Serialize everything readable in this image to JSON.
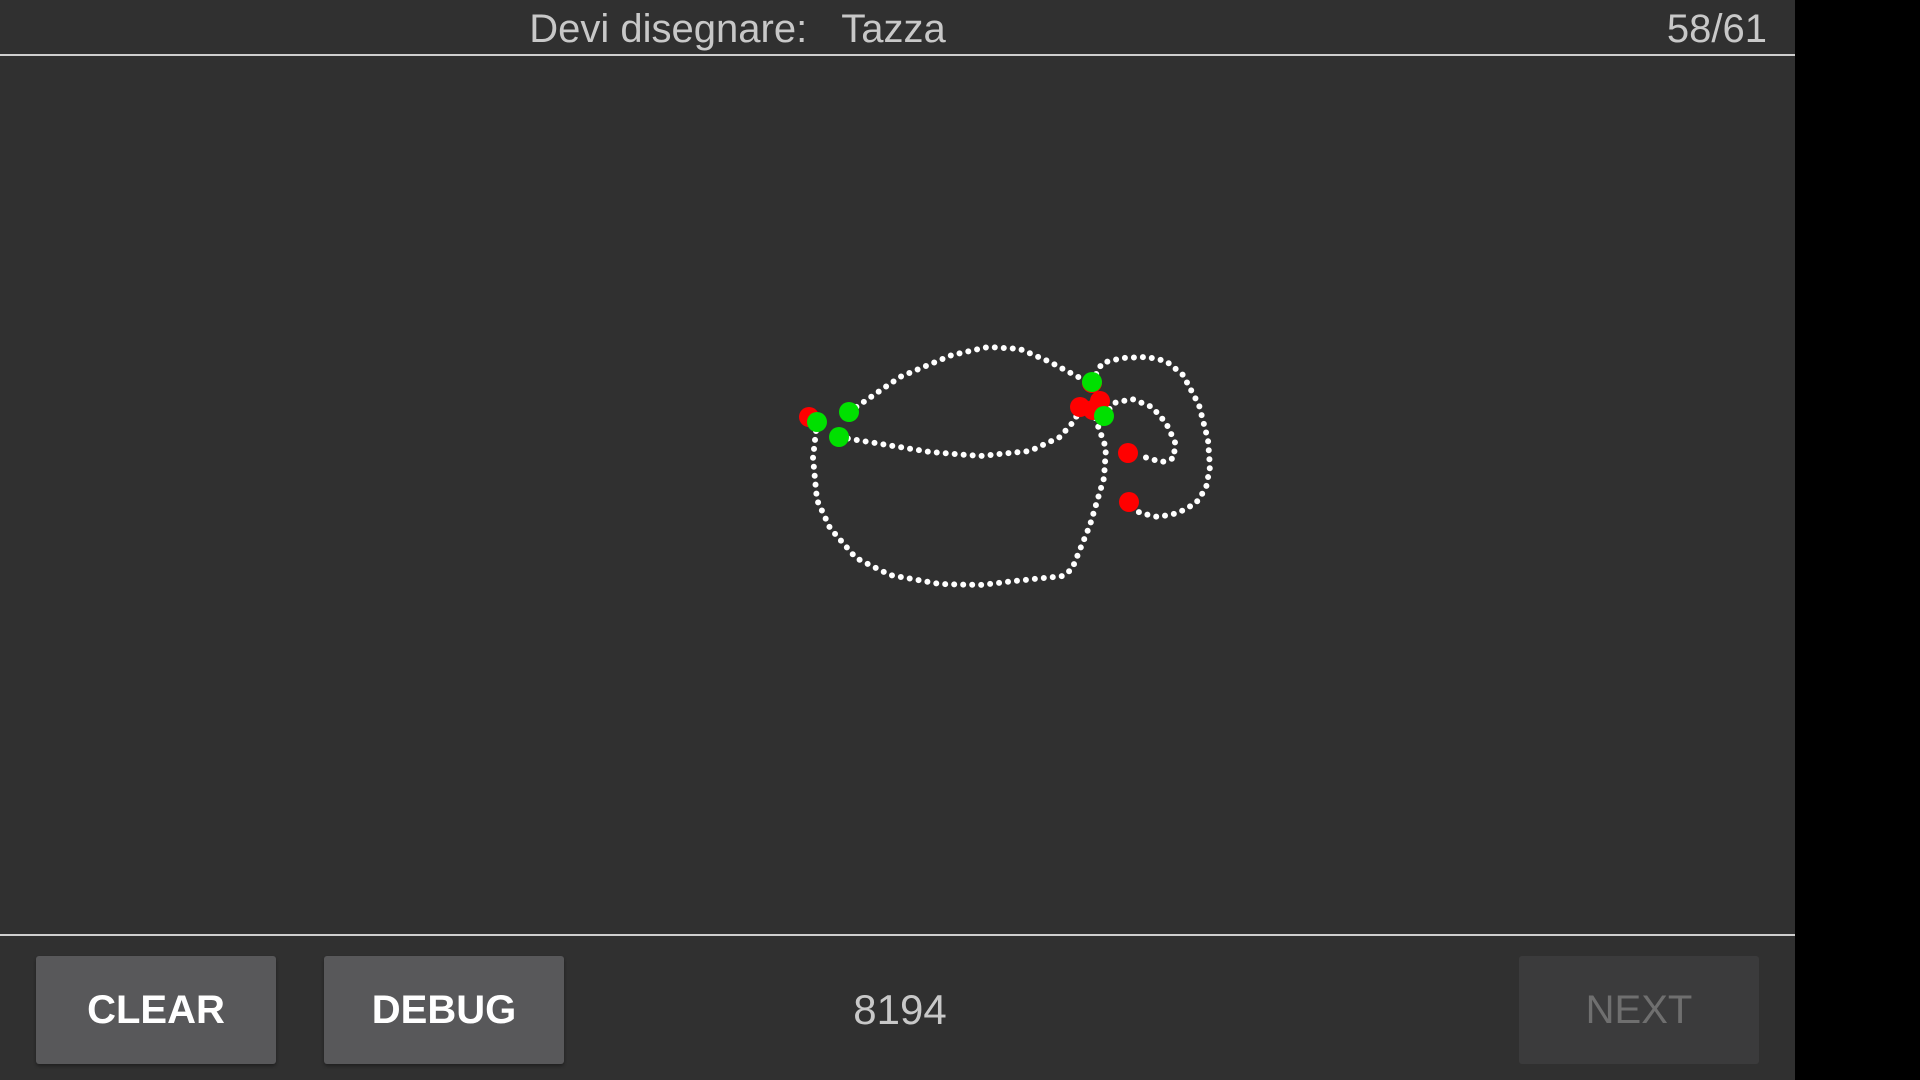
{
  "header": {
    "prompt_label": "Devi disegnare:",
    "prompt_word": "Tazza",
    "progress": "58/61"
  },
  "footer": {
    "clear_label": "CLEAR",
    "debug_label": "DEBUG",
    "score": "8194",
    "next_label": "NEXT",
    "next_enabled": false
  },
  "drawing": {
    "stroke_color": "#ffffff",
    "start_marker_color": "#00e000",
    "end_marker_color": "#ff0000",
    "stroke_count": 5
  }
}
